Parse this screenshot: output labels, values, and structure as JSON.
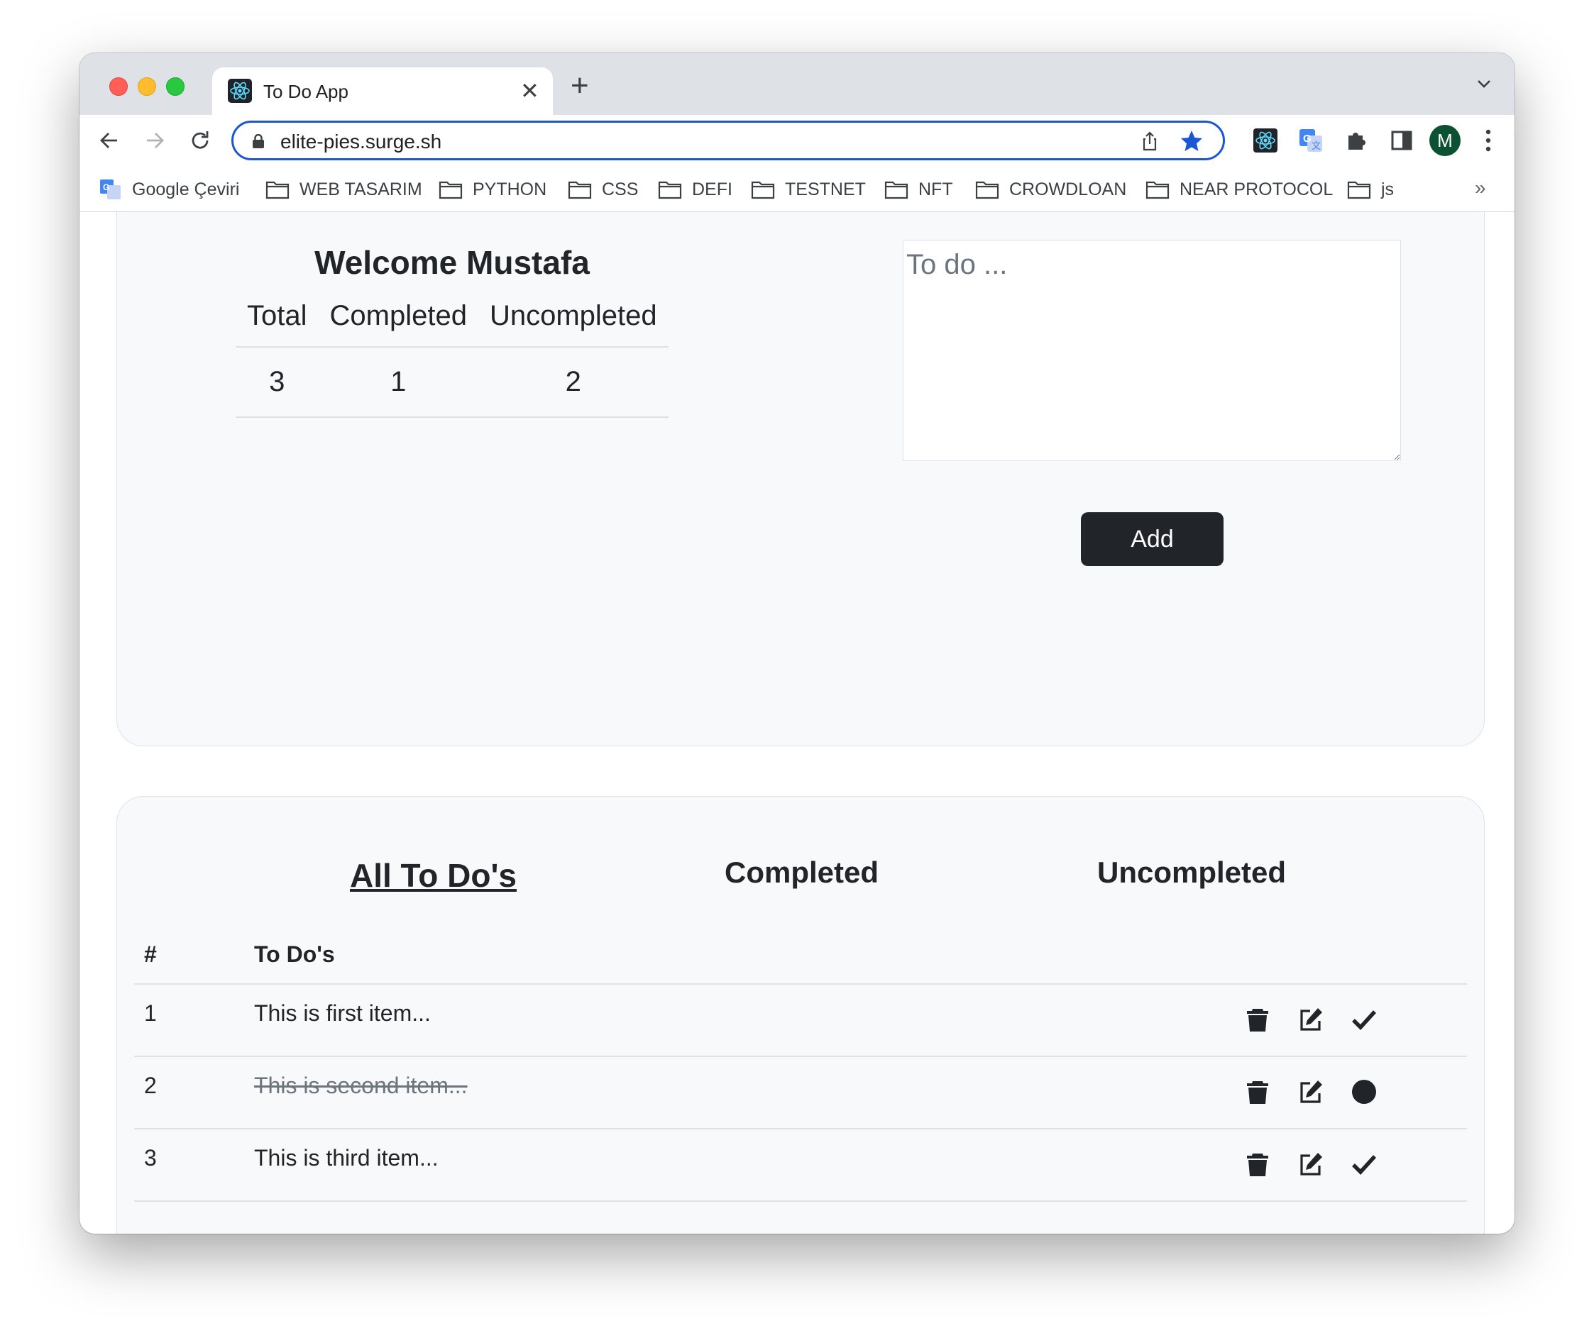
{
  "browser": {
    "tab_title": "To Do App",
    "url": "elite-pies.surge.sh",
    "profile_initial": "M",
    "bookmarks": [
      "Google Çeviri",
      "WEB TASARIM",
      "PYTHON",
      "CSS",
      "DEFI",
      "TESTNET",
      "NFT",
      "CROWDLOAN",
      "NEAR PROTOCOL",
      "js"
    ],
    "bookmarks_overflow": "»",
    "accent_color": "#1a57d3"
  },
  "summary": {
    "welcome": "Welcome Mustafa",
    "headers": [
      "Total",
      "Completed",
      "Uncompleted"
    ],
    "values": [
      "3",
      "1",
      "2"
    ]
  },
  "form": {
    "placeholder": "To do ...",
    "value": "",
    "add_label": "Add"
  },
  "filters": {
    "all": "All To Do's",
    "completed": "Completed",
    "uncompleted": "Uncompleted",
    "active": "all"
  },
  "todos": {
    "headers": [
      "#",
      "To Do's"
    ],
    "items": [
      {
        "num": "1",
        "text": "This is first item...",
        "completed": false,
        "status_icon": "check-icon"
      },
      {
        "num": "2",
        "text": "This is second item...",
        "completed": true,
        "status_icon": "circle-icon"
      },
      {
        "num": "3",
        "text": "This is third item...",
        "completed": false,
        "status_icon": "check-icon"
      }
    ]
  },
  "icons": {
    "delete": "trash-icon",
    "edit": "edit-icon",
    "complete": "check-icon",
    "uncomplete": "circle-icon"
  }
}
